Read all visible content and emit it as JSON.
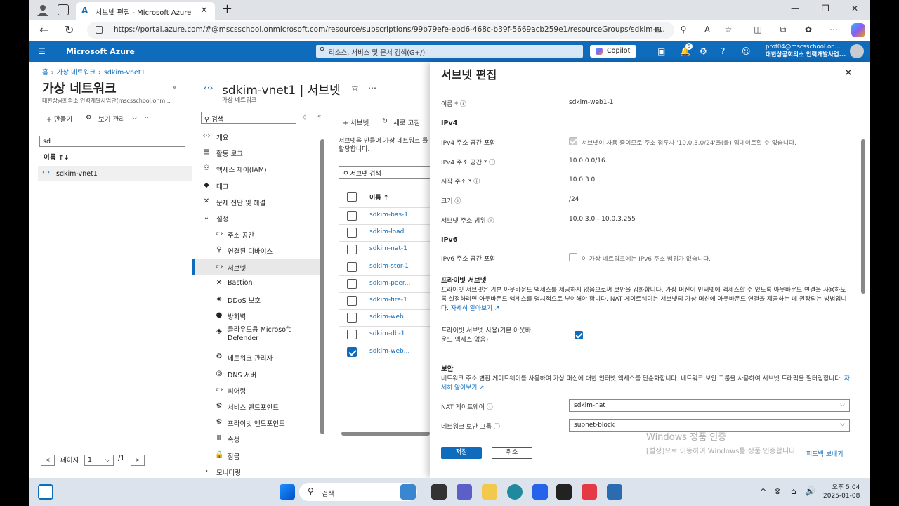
{
  "browser": {
    "tab_title": "서브넷 편집 - Microsoft Azure",
    "url": "https://portal.azure.com/#@mscsschool.onmicrosoft.com/resource/subscriptions/99b79efe-ebd6-468c-b39f-5669acb259e1/resourceGroups/sdkim-r..."
  },
  "azure": {
    "brand": "Microsoft Azure",
    "search_placeholder": "리소스, 서비스 및 문서 검색(G+/)",
    "copilot_label": "Copilot",
    "notification_count": "5",
    "user_email": "prof04@mscsschool.on...",
    "user_org": "대한상공회의소 인력개발사업...",
    "colors": {
      "accent": "#0f6cbd"
    }
  },
  "left": {
    "breadcrumb": [
      "홈",
      "가상 네트워크",
      "sdkim-vnet1"
    ],
    "title": "가상 네트워크",
    "subtitle": "대한상공회의소 인력개발사업단(mscsschool.onm...",
    "create_label": "+ 만들기",
    "view_label": "보기 관리",
    "filter_value": "sd",
    "column_name": "이름 ↑↓",
    "rows": [
      "sdkim-vnet1"
    ],
    "page_label": "페이지",
    "page_value": "1",
    "page_total": "/1"
  },
  "vnet": {
    "title": "sdkim-vnet1 | 서브넷",
    "subtitle": "가상 네트워크",
    "search_placeholder": "검색",
    "menu": [
      {
        "icon": "‹·›",
        "label": "개요"
      },
      {
        "icon": "▤",
        "label": "활동 로그"
      },
      {
        "icon": "⚇",
        "label": "액세스 제어(IAM)"
      },
      {
        "icon": "◆",
        "label": "태그"
      },
      {
        "icon": "✕",
        "label": "문제 진단 및 해결"
      },
      {
        "icon": "⌄",
        "label": "설정"
      }
    ],
    "submenu": [
      {
        "icon": "‹·›",
        "label": "주소 공간"
      },
      {
        "icon": "⚲",
        "label": "연결된 디바이스"
      },
      {
        "icon": "‹·›",
        "label": "서브넷"
      },
      {
        "icon": "✕",
        "label": "Bastion"
      },
      {
        "icon": "◈",
        "label": "DDoS 보호"
      },
      {
        "icon": "●",
        "label": "방화벽"
      },
      {
        "icon": "◈",
        "label": "클라우드용 Microsoft Defender"
      },
      {
        "icon": "⚙",
        "label": "네트워크 관리자"
      },
      {
        "icon": "◎",
        "label": "DNS 서버"
      },
      {
        "icon": "‹·›",
        "label": "피어링"
      },
      {
        "icon": "⚙",
        "label": "서비스 엔드포인트"
      },
      {
        "icon": "⚙",
        "label": "프라이빗 엔드포인트"
      },
      {
        "icon": "Ⅲ",
        "label": "속성"
      },
      {
        "icon": "🔒",
        "label": "잠금"
      }
    ],
    "monitoring_label": "모니터링"
  },
  "subnets": {
    "add_label": "+ 서브넷",
    "refresh_label": "새로 고침",
    "description": "서브넷을 만들어 가상 네트워크 를 할당합니다.",
    "search_placeholder": "서브넷 검색",
    "column_name": "이름 ↑",
    "rows": [
      {
        "name": "sdkim-bas-1",
        "checked": false
      },
      {
        "name": "sdkim-load...",
        "checked": false
      },
      {
        "name": "sdkim-nat-1",
        "checked": false
      },
      {
        "name": "sdkim-stor-1",
        "checked": false
      },
      {
        "name": "sdkim-peer...",
        "checked": false
      },
      {
        "name": "sdkim-fire-1",
        "checked": false
      },
      {
        "name": "sdkim-web...",
        "checked": false
      },
      {
        "name": "sdkim-db-1",
        "checked": false
      },
      {
        "name": "sdkim-web...",
        "checked": true
      }
    ]
  },
  "panel": {
    "title": "서브넷 편집",
    "name_label": "이름 * ⓘ",
    "name_value": "sdkim-web1-1",
    "ipv4_heading": "IPv4",
    "ipv4_include_label": "IPv4 주소 공간 포함",
    "ipv4_include_text": "서브넷이 사용 중이므로 주소 접두사 '10.0.3.0/24'을(를) 업데이트할 수 없습니다.",
    "ipv4_space_label": "IPv4 주소 공간 * ⓘ",
    "ipv4_space_value": "10.0.0.0/16",
    "start_label": "시작 주소 * ⓘ",
    "start_value": "10.0.3.0",
    "size_label": "크기 ⓘ",
    "size_value": "/24",
    "range_label": "서브넷 주소 범위 ⓘ",
    "range_value": "10.0.3.0 - 10.0.3.255",
    "ipv6_heading": "IPv6",
    "ipv6_include_label": "IPv6 주소 공간 포함",
    "ipv6_include_text": "이 가상 네트워크에는 IPv6 주소 범위가 없습니다.",
    "private_heading": "프라이빗 서브넷",
    "private_desc": "프라이빗 서브넷은 기본 아웃바운드 액세스를 제공하지 않음으로써 보안을 강화합니다. 가상 머신이 인터넷에 액세스할 수 있도록 아웃바운드 연결을 사용하도록 설정하려면 아웃바운드 액세스를 명시적으로 부여해야 합니다. NAT 게이트웨이는 서브넷의 가상 머신에 아웃바운드 연결을 제공하는 데 권장되는 방법입니다.",
    "learn_more": "자세히 알아보기 ↗",
    "private_enable_label": "프라이빗 서브넷 사용(기본 아웃바운드 액세스 없음)",
    "security_heading": "보안",
    "security_desc": "네트워크 주소 변환 게이트웨이를 사용하여 가상 머신에 대한 인터넷 액세스를 단순화합니다. 네트워크 보안 그룹을 사용하여 서브넷 트래픽을 필터링합니다.",
    "nat_label": "NAT 게이트웨이 ⓘ",
    "nat_value": "sdkim-nat",
    "nsg_label": "네트워크 보안 그룹 ⓘ",
    "nsg_value": "subnet-block",
    "save_label": "저장",
    "cancel_label": "취소",
    "feedback_label": "피드백 보내기",
    "watermark_title": "Windows 정품 인증",
    "watermark_text": "[설정]으로 이동하여 Windows를 정품 인증합니다."
  },
  "taskbar": {
    "search_placeholder": "검색",
    "time": "오후 5:04",
    "date": "2025-01-08"
  }
}
